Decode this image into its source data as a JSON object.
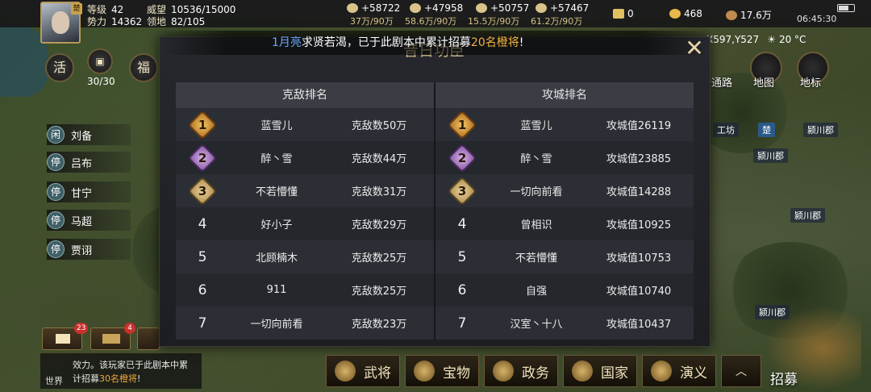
{
  "player": {
    "level_label": "等级",
    "level": "42",
    "power_label": "势力",
    "power": "14362",
    "prestige_label": "威望",
    "prestige": "10536/15000",
    "territory_label": "领地",
    "territory": "82/105",
    "avatar_badge": "楚"
  },
  "resources": [
    {
      "value": "+58722",
      "sub": "37万/90万"
    },
    {
      "value": "+47958",
      "sub": "58.6万/90万"
    },
    {
      "value": "+50757",
      "sub": "15.5万/90万"
    },
    {
      "value": "+57467",
      "sub": "61.2万/90万"
    }
  ],
  "currency": {
    "gold_bar": "0",
    "coins": "468",
    "copper": "17.6万"
  },
  "clock": "06:45:30",
  "left_buttons": {
    "huo": "活",
    "fu": "福",
    "count": "30/30"
  },
  "heroes": [
    {
      "tag": "闲",
      "name": "刘备"
    },
    {
      "tag": "停",
      "name": "吕布"
    },
    {
      "tag": "停",
      "name": "甘宁"
    },
    {
      "tag": "停",
      "name": "马超"
    },
    {
      "tag": "停",
      "name": "贾诩"
    }
  ],
  "right_panel": {
    "coords": "X597,Y527",
    "weather": "20 °C",
    "road_label": "通路",
    "map_label": "地图",
    "marker_label": "地标"
  },
  "map_labels": {
    "workshop": "工坊",
    "yingchuan1": "颍川郡",
    "yingchuan2": "颍川郡",
    "yingchuan3": "颍川郡",
    "yingchuan4": "颍川郡",
    "chu": "楚"
  },
  "notifications": {
    "mail_count": "23",
    "second_count": "4"
  },
  "chat": {
    "channel": "世界",
    "line1": "效力。该玩家已于此剧本中累",
    "line2_a": "计招募",
    "line2_hl": "30名橙将",
    "line2_b": "!"
  },
  "bottom_tabs": [
    "武将",
    "宝物",
    "政务",
    "国家",
    "演义"
  ],
  "recruit_label": "招募",
  "ticker": {
    "blue": "1月亮",
    "a": "求贤若渴，已于此剧本中累计招募",
    "gold": "20名橙将",
    "b": "!"
  },
  "modal": {
    "title": "昔日功臣",
    "close": "✕",
    "left_header": "克敌排名",
    "right_header": "攻城排名",
    "left_rows": [
      {
        "rank": "1",
        "name": "蓝雪儿",
        "value": "克敌数50万"
      },
      {
        "rank": "2",
        "name": "醉丶雪",
        "value": "克敌数44万"
      },
      {
        "rank": "3",
        "name": "不若懵懂",
        "value": "克敌数31万"
      },
      {
        "rank": "4",
        "name": "好小子",
        "value": "克敌数29万"
      },
      {
        "rank": "5",
        "name": "北顾楠木",
        "value": "克敌数25万"
      },
      {
        "rank": "6",
        "name": "911",
        "value": "克敌数25万"
      },
      {
        "rank": "7",
        "name": "一切向前看",
        "value": "克敌数23万"
      }
    ],
    "right_rows": [
      {
        "rank": "1",
        "name": "蓝雪儿",
        "value": "攻城值26119"
      },
      {
        "rank": "2",
        "name": "醉丶雪",
        "value": "攻城值23885"
      },
      {
        "rank": "3",
        "name": "一切向前看",
        "value": "攻城值14288"
      },
      {
        "rank": "4",
        "name": "曾相识",
        "value": "攻城值10925"
      },
      {
        "rank": "5",
        "name": "不若懵懂",
        "value": "攻城值10753"
      },
      {
        "rank": "6",
        "name": "自强",
        "value": "攻城值10740"
      },
      {
        "rank": "7",
        "name": "汉室丶十八",
        "value": "攻城值10437"
      }
    ]
  }
}
